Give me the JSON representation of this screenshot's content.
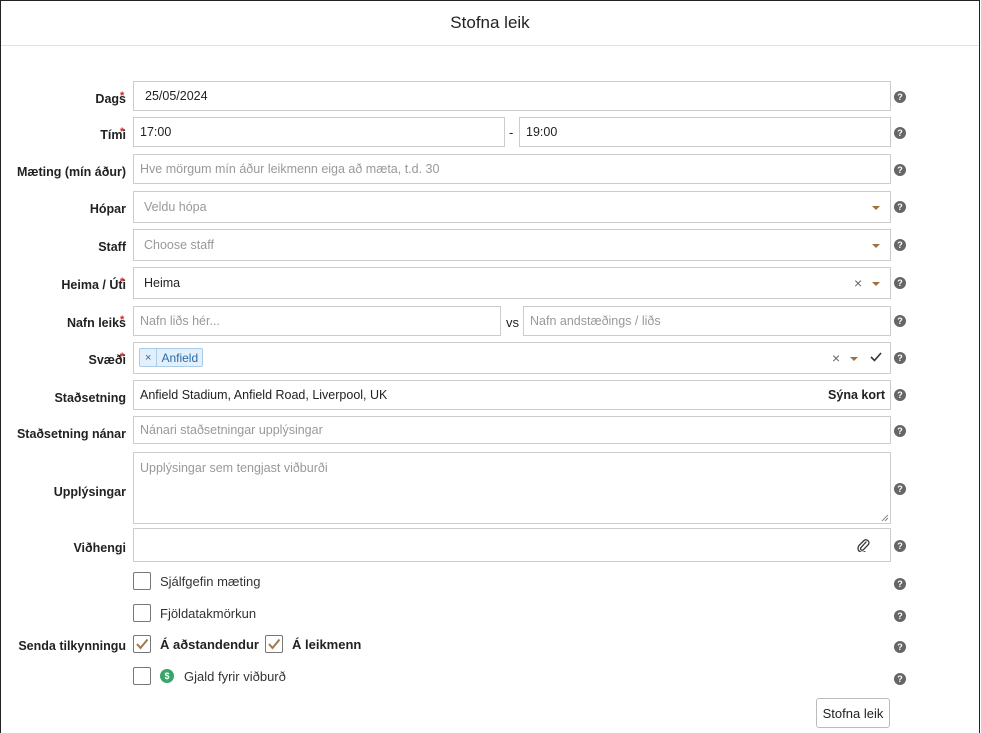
{
  "modal": {
    "title": "Stofna leik"
  },
  "fields": {
    "date": {
      "label": "Dags",
      "value": "25/05/2024"
    },
    "time": {
      "label": "Tími",
      "start": "17:00",
      "separator": "-",
      "end": "19:00"
    },
    "arrival": {
      "label": "Mæting (mín áður)",
      "placeholder": "Hve mörgum mín áður leikmenn eiga að mæta, t.d. 30"
    },
    "groups": {
      "label": "Hópar",
      "placeholder": "Veldu hópa"
    },
    "staff": {
      "label": "Staff",
      "placeholder": "Choose staff"
    },
    "home_away": {
      "label": "Heima / Úti",
      "value": "Heima"
    },
    "game_name": {
      "label": "Nafn leiks",
      "team_placeholder": "Nafn liðs hér...",
      "vs": "vs",
      "opponent_placeholder": "Nafn andstæðings / liðs"
    },
    "area": {
      "label": "Svæði",
      "tag_remove": "×",
      "tag": "Anfield"
    },
    "location": {
      "label": "Staðsetning",
      "value": "Anfield Stadium, Anfield Road, Liverpool, UK",
      "map_link": "Sýna kort"
    },
    "location_detail": {
      "label": "Staðsetning nánar",
      "placeholder": "Nánari staðsetningar upplýsingar"
    },
    "info": {
      "label": "Upplýsingar",
      "placeholder": "Upplýsingar sem tengjast viðburði"
    },
    "attachment": {
      "label": "Viðhengi"
    }
  },
  "options": {
    "default_attendance": {
      "label": "Sjálfgefin mæting",
      "checked": false
    },
    "participant_limit": {
      "label": "Fjöldatakmörkun",
      "checked": false
    },
    "notify": {
      "label": "Senda tilkynningu",
      "guardians": {
        "label": "Á aðstandendur",
        "checked": true
      },
      "players": {
        "label": "Á leikmenn",
        "checked": true
      }
    },
    "fee": {
      "label": "Gjald fyrir viðburð",
      "checked": false,
      "icon": "$"
    }
  },
  "common": {
    "required_mark": "*",
    "help_icon": "?",
    "clear_icon": "×"
  },
  "actions": {
    "submit": "Stofna leik"
  },
  "colors": {
    "required": "#dd2222",
    "tag_bg": "#e3f0fb",
    "tag_text": "#2a6aa8",
    "money_icon": "#3aa56a",
    "check": "#a07850"
  }
}
